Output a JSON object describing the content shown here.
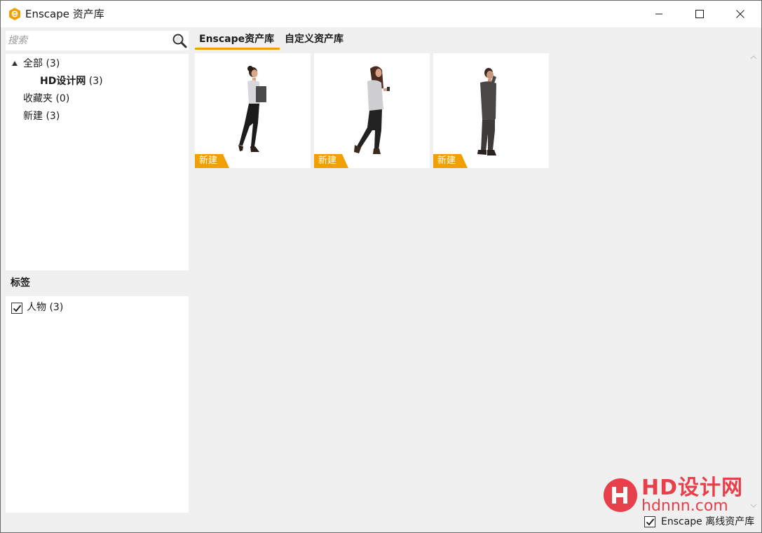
{
  "window": {
    "title": "Enscape 资产库"
  },
  "search": {
    "placeholder": "搜索",
    "value": ""
  },
  "tree": {
    "items": [
      {
        "label": "全部",
        "count": "(3)"
      },
      {
        "label": "HD设计网",
        "count": "(3)"
      },
      {
        "label": "收藏夹",
        "count": "(0)"
      },
      {
        "label": "新建",
        "count": "(3)"
      }
    ]
  },
  "tags": {
    "header": "标签",
    "items": [
      {
        "label": "人物 (3)",
        "checked": true
      }
    ]
  },
  "tabs": [
    {
      "label": "Enscape资产库",
      "active": true
    },
    {
      "label": "自定义资产库",
      "active": false
    }
  ],
  "assets": [
    {
      "badge": "新建",
      "figure": "woman-holding-folder"
    },
    {
      "badge": "新建",
      "figure": "woman-with-phone"
    },
    {
      "badge": "新建",
      "figure": "man-on-phone"
    }
  ],
  "watermark": {
    "title": "HD设计网",
    "url": "hdnnn.com"
  },
  "footer": {
    "offline_label": "Enscape 离线资产库",
    "offline_checked": true
  },
  "colors": {
    "accent": "#f0a000",
    "watermark": "#e8404a",
    "background": "#f0f0f0",
    "panel": "#ffffff"
  }
}
